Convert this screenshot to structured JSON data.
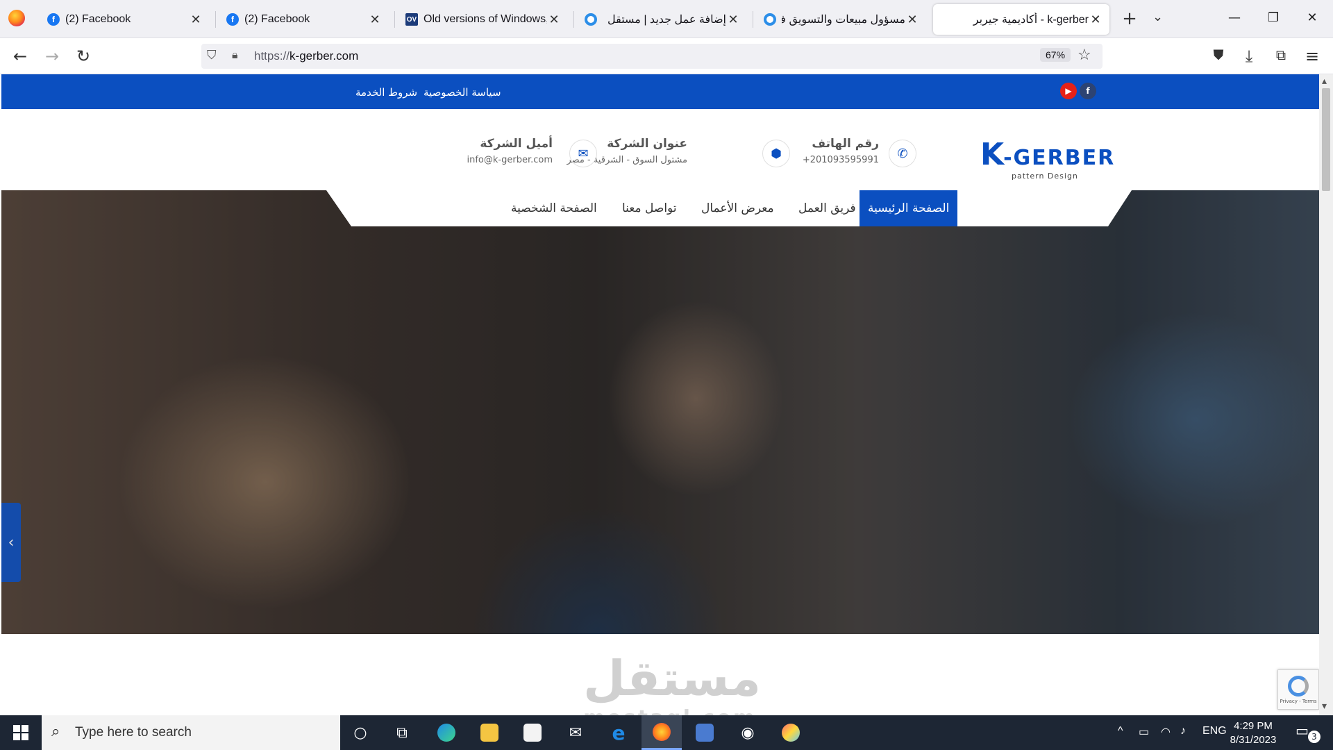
{
  "browser": {
    "tabs": [
      {
        "title": "(2) Facebook",
        "favicon": "facebook-icon",
        "active": false
      },
      {
        "title": "(2) Facebook",
        "favicon": "facebook-icon",
        "active": false
      },
      {
        "title": "Old versions of Windows, M",
        "favicon": "ov-icon",
        "active": false
      },
      {
        "title": "إضافة عمل جديد | مستقل",
        "favicon": "ring-icon",
        "active": false
      },
      {
        "title": "مسؤول مبيعات والتسويق ف",
        "favicon": "ring-icon",
        "active": false
      },
      {
        "title": "k-gerber - أكاديمية جيربر",
        "favicon": "none",
        "active": true
      }
    ],
    "url_protocol": "https://",
    "url_host": "k-gerber.com",
    "zoom": "67%"
  },
  "site": {
    "topbar": {
      "links": [
        "سياسة الخصوصية",
        "شروط الخدمة"
      ],
      "social": [
        {
          "name": "youtube-icon",
          "glyph": "▶",
          "color": "#e62117"
        },
        {
          "name": "facebook-icon",
          "glyph": "f",
          "color": "#2d4373"
        }
      ]
    },
    "logo": {
      "k": "K",
      "rest": "-GERBER",
      "tagline": "pattern Design"
    },
    "contacts": {
      "phone": {
        "title": "رقم الهاتف",
        "value": "201093595991+"
      },
      "address": {
        "title": "عنوان الشركة",
        "value": "مشتول السوق - الشرقية - مصر"
      },
      "email": {
        "title": "أميل الشركة",
        "value": "info@k-gerber.com"
      }
    },
    "menu": [
      {
        "label": "الصفحة الرئيسية",
        "active": true
      },
      {
        "label": "فريق العمل",
        "active": false
      },
      {
        "label": "معرض الأعمال",
        "active": false
      },
      {
        "label": "تواصل معنا",
        "active": false
      },
      {
        "label": "الصفحة الشخصية",
        "active": false
      }
    ],
    "colors": {
      "brand": "#0b4fc0"
    },
    "watermark": {
      "main": "مستقل",
      "sub": "mostaql.com"
    },
    "recaptcha": "Privacy - Terms"
  },
  "taskbar": {
    "search_placeholder": "Type here to search",
    "language": "ENG",
    "time": "4:29 PM",
    "date": "8/31/2023",
    "notifications": "3"
  }
}
